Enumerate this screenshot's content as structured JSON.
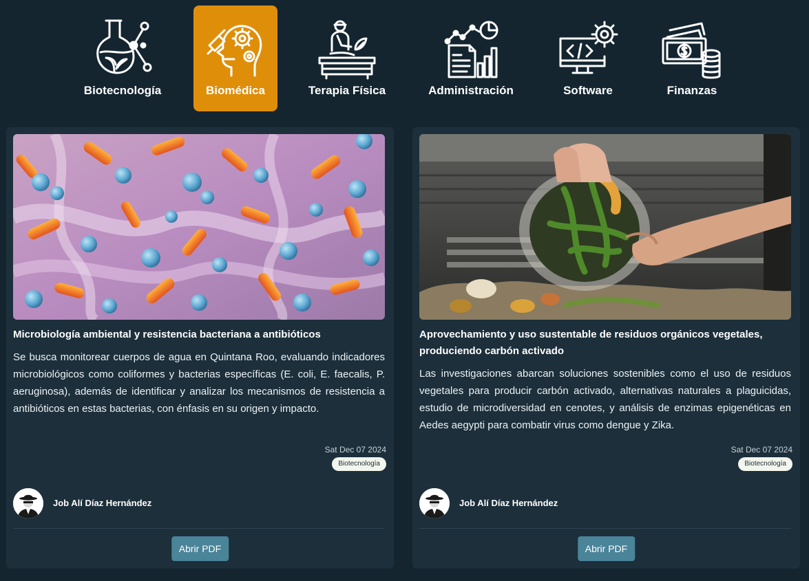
{
  "categories": [
    {
      "label": "Biotecnología",
      "icon": "flask-molecule-icon",
      "active": false
    },
    {
      "label": "Biomédica",
      "icon": "head-gears-icon",
      "active": true
    },
    {
      "label": "Terapia Física",
      "icon": "physiotherapy-icon",
      "active": false
    },
    {
      "label": "Administración",
      "icon": "report-chart-icon",
      "active": false
    },
    {
      "label": "Software",
      "icon": "monitor-code-gear-icon",
      "active": false
    },
    {
      "label": "Finanzas",
      "icon": "money-coins-icon",
      "active": false
    }
  ],
  "colors": {
    "background": "#14252f",
    "card": "#1c2f3b",
    "active_tab": "#df8e0a",
    "button": "#4a8499"
  },
  "cards": [
    {
      "image": "bacteria-microscopy-image",
      "title": "Microbiología ambiental y resistencia bacteriana a antibióticos",
      "description": "Se busca monitorear cuerpos de agua en Quintana Roo, evaluando indicadores microbiológicos como coliformes y bacterias específicas (E. coli, E. faecalis, P. aeruginosa), además de identificar y analizar los mecanismos de resistencia a antibióticos en estas bacterias, con énfasis en su origen y impacto.",
      "date": "Sat Dec 07 2024",
      "tag": "Biotecnología",
      "author": "Job Alí Díaz Hernández",
      "button": "Abrir PDF"
    },
    {
      "image": "organic-waste-compost-image",
      "title": "Aprovechamiento y uso sustentable de residuos orgánicos vegetales, produciendo carbón activado",
      "description": "Las investigaciones abarcan soluciones sostenibles como el uso de residuos vegetales para producir carbón activado, alternativas naturales a plaguicidas, estudio de microdiversidad en cenotes, y análisis de enzimas epigenéticas en Aedes aegypti para combatir virus como dengue y Zika.",
      "date": "Sat Dec 07 2024",
      "tag": "Biotecnología",
      "author": "Job Alí Díaz Hernández",
      "button": "Abrir PDF"
    }
  ]
}
